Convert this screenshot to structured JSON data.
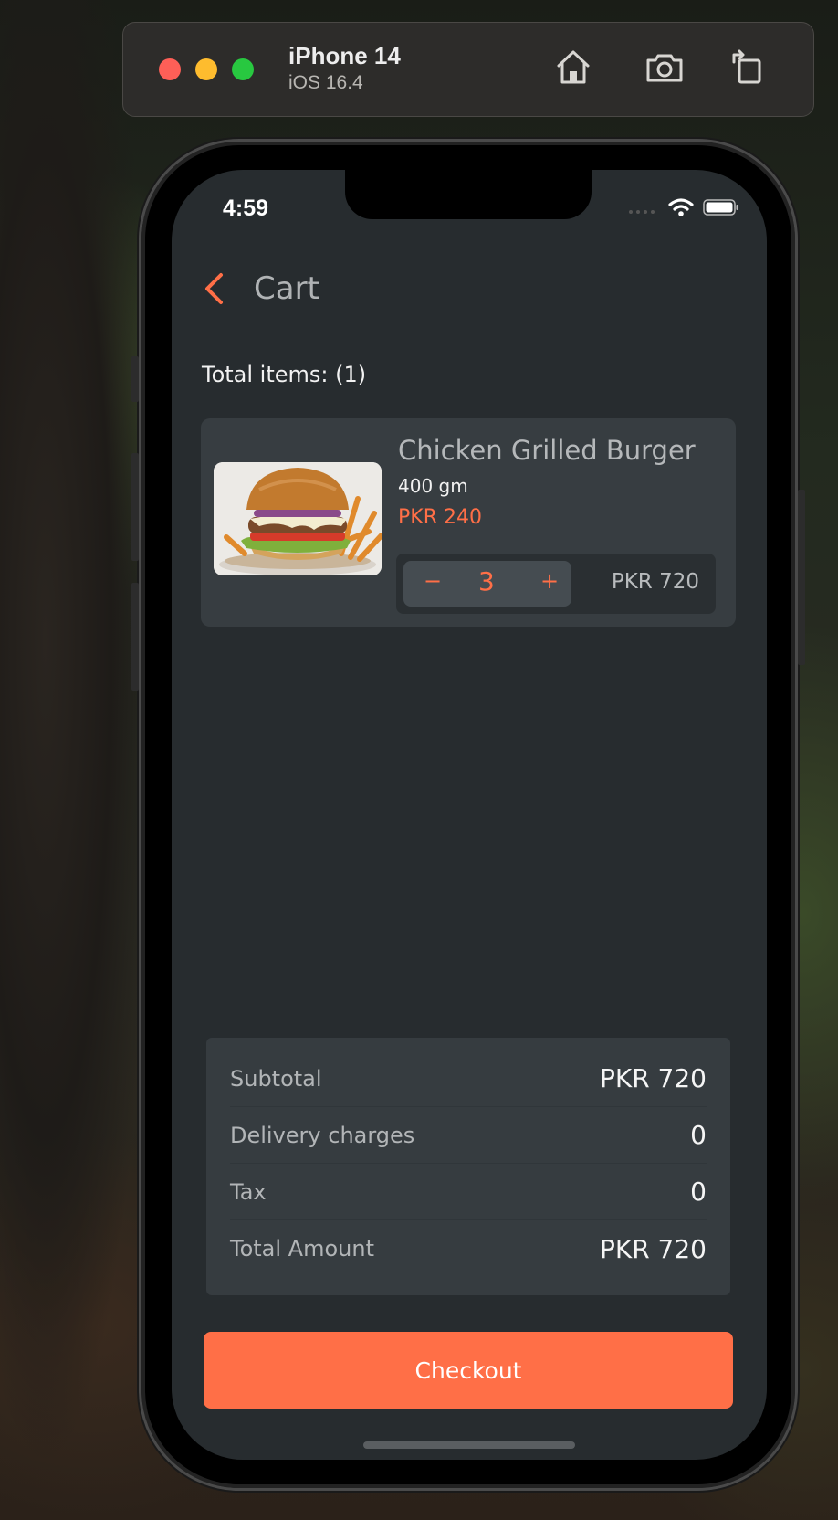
{
  "simulator": {
    "device_name": "iPhone 14",
    "os_version": "iOS 16.4",
    "icons": [
      "home-icon",
      "screenshot-icon",
      "rotate-icon"
    ]
  },
  "status_bar": {
    "time": "4:59"
  },
  "header": {
    "title": "Cart"
  },
  "cart": {
    "total_items_label": "Total items: (1)",
    "items": [
      {
        "name": "Chicken Grilled Burger",
        "weight": "400 gm",
        "price": "PKR 240",
        "quantity": "3",
        "decrement_label": "−",
        "increment_label": "+",
        "line_total": "PKR 720"
      }
    ]
  },
  "summary": {
    "rows": [
      {
        "label": "Subtotal",
        "value": "PKR 720"
      },
      {
        "label": "Delivery charges",
        "value": "0"
      },
      {
        "label": "Tax",
        "value": "0"
      },
      {
        "label": "Total Amount",
        "value": "PKR 720"
      }
    ]
  },
  "checkout": {
    "label": "Checkout"
  },
  "colors": {
    "accent": "#ff6f47",
    "screen_bg": "#272c2f",
    "card_bg": "#373d41"
  }
}
